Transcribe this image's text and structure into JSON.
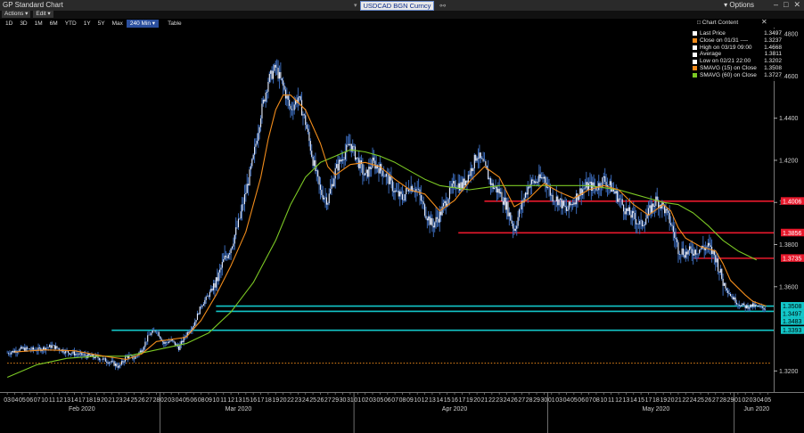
{
  "window": {
    "title": "GP Standard Chart",
    "ticker": "USDCAD BGN Curncy",
    "options_label": "Options"
  },
  "menu": {
    "actions": "Actions",
    "edit": "Edit"
  },
  "toolbar": {
    "ranges": [
      "1D",
      "3D",
      "1M",
      "6M",
      "YTD",
      "1Y",
      "5Y",
      "Max"
    ],
    "interval": "240 Min",
    "table": "Table"
  },
  "chart_content_label": "Chart Content",
  "legend": [
    {
      "label": "Last Price",
      "value": "1.3497",
      "color": "#ffffff"
    },
    {
      "label": "Close on 01/31 ----",
      "value": "1.3237",
      "color": "#f28c1b"
    },
    {
      "label": "High on 03/19 09:00",
      "value": "1.4668",
      "color": "#ffffff"
    },
    {
      "label": "Average",
      "value": "1.3811",
      "color": "#ffffff"
    },
    {
      "label": "Low on 02/21 22:00",
      "value": "1.3202",
      "color": "#ffffff"
    },
    {
      "label": "SMAVG (15)  on Close",
      "value": "1.3508",
      "color": "#f28c1b"
    },
    {
      "label": "SMAVG (60)  on Close",
      "value": "1.3727",
      "color": "#7cc924"
    }
  ],
  "chart_data": {
    "type": "line",
    "ylim": [
      1.31,
      1.483
    ],
    "yticks": [
      "1.4800",
      "1.4600",
      "1.4400",
      "1.4200",
      "1.4000",
      "1.3800",
      "1.3600",
      "1.3200"
    ],
    "ytick_values": [
      1.48,
      1.46,
      1.44,
      1.42,
      1.4,
      1.38,
      1.36,
      1.32
    ],
    "price_tags": [
      {
        "text": "1.4006",
        "value": 1.4006,
        "color": "#e8192c",
        "fg": "#ffffff"
      },
      {
        "text": "1.3856",
        "value": 1.3856,
        "color": "#e8192c",
        "fg": "#ffffff"
      },
      {
        "text": "1.3735",
        "value": 1.3735,
        "color": "#e8192c",
        "fg": "#ffffff"
      },
      {
        "text": "1.3508",
        "value": 1.3508,
        "color": "#13c7c9",
        "fg": "#000000"
      },
      {
        "text": "1.3497",
        "value": 1.3497,
        "color": "#13c7c9",
        "fg": "#000000"
      },
      {
        "text": "1.3483",
        "value": 1.3483,
        "color": "#13c7c9",
        "fg": "#000000"
      },
      {
        "text": "1.3393",
        "value": 1.3393,
        "color": "#13c7c9",
        "fg": "#000000"
      }
    ],
    "days": [
      {
        "label": "03",
        "t": 0
      },
      {
        "label": "04",
        "t": 1
      },
      {
        "label": "05",
        "t": 2
      },
      {
        "label": "06",
        "t": 3
      },
      {
        "label": "07",
        "t": 4
      },
      {
        "label": "10",
        "t": 5
      },
      {
        "label": "11",
        "t": 6
      },
      {
        "label": "12",
        "t": 7
      },
      {
        "label": "13",
        "t": 8
      },
      {
        "label": "14",
        "t": 9
      },
      {
        "label": "17",
        "t": 10
      },
      {
        "label": "18",
        "t": 11
      },
      {
        "label": "19",
        "t": 12
      },
      {
        "label": "20",
        "t": 13
      },
      {
        "label": "21",
        "t": 14
      },
      {
        "label": "23",
        "t": 15
      },
      {
        "label": "24",
        "t": 16
      },
      {
        "label": "25",
        "t": 17
      },
      {
        "label": "26",
        "t": 18
      },
      {
        "label": "27",
        "t": 19
      },
      {
        "label": "28",
        "t": 20
      },
      {
        "label": "02",
        "t": 21
      },
      {
        "label": "03",
        "t": 22
      },
      {
        "label": "04",
        "t": 23
      },
      {
        "label": "05",
        "t": 24
      },
      {
        "label": "06",
        "t": 25
      },
      {
        "label": "08",
        "t": 26
      },
      {
        "label": "09",
        "t": 27
      },
      {
        "label": "10",
        "t": 28
      },
      {
        "label": "11",
        "t": 29
      },
      {
        "label": "12",
        "t": 30
      },
      {
        "label": "13",
        "t": 31
      },
      {
        "label": "15",
        "t": 32
      },
      {
        "label": "16",
        "t": 33
      },
      {
        "label": "17",
        "t": 34
      },
      {
        "label": "18",
        "t": 35
      },
      {
        "label": "19",
        "t": 36
      },
      {
        "label": "20",
        "t": 37
      },
      {
        "label": "22",
        "t": 38
      },
      {
        "label": "23",
        "t": 39
      },
      {
        "label": "24",
        "t": 40
      },
      {
        "label": "25",
        "t": 41
      },
      {
        "label": "26",
        "t": 42
      },
      {
        "label": "27",
        "t": 43
      },
      {
        "label": "29",
        "t": 44
      },
      {
        "label": "30",
        "t": 45
      },
      {
        "label": "31",
        "t": 46
      },
      {
        "label": "01",
        "t": 47
      },
      {
        "label": "02",
        "t": 48
      },
      {
        "label": "03",
        "t": 49
      },
      {
        "label": "05",
        "t": 50
      },
      {
        "label": "06",
        "t": 51
      },
      {
        "label": "07",
        "t": 52
      },
      {
        "label": "08",
        "t": 53
      },
      {
        "label": "09",
        "t": 54
      },
      {
        "label": "10",
        "t": 55
      },
      {
        "label": "12",
        "t": 56
      },
      {
        "label": "13",
        "t": 57
      },
      {
        "label": "14",
        "t": 58
      },
      {
        "label": "15",
        "t": 59
      },
      {
        "label": "16",
        "t": 60
      },
      {
        "label": "17",
        "t": 61
      },
      {
        "label": "19",
        "t": 62
      },
      {
        "label": "20",
        "t": 63
      },
      {
        "label": "21",
        "t": 64
      },
      {
        "label": "22",
        "t": 65
      },
      {
        "label": "23",
        "t": 66
      },
      {
        "label": "24",
        "t": 67
      },
      {
        "label": "26",
        "t": 68
      },
      {
        "label": "27",
        "t": 69
      },
      {
        "label": "28",
        "t": 70
      },
      {
        "label": "29",
        "t": 71
      },
      {
        "label": "30",
        "t": 72
      },
      {
        "label": "01",
        "t": 73
      },
      {
        "label": "03",
        "t": 74
      },
      {
        "label": "04",
        "t": 75
      },
      {
        "label": "05",
        "t": 76
      },
      {
        "label": "06",
        "t": 77
      },
      {
        "label": "07",
        "t": 78
      },
      {
        "label": "08",
        "t": 79
      },
      {
        "label": "10",
        "t": 80
      },
      {
        "label": "11",
        "t": 81
      },
      {
        "label": "12",
        "t": 82
      },
      {
        "label": "13",
        "t": 83
      },
      {
        "label": "14",
        "t": 84
      },
      {
        "label": "15",
        "t": 85
      },
      {
        "label": "17",
        "t": 86
      },
      {
        "label": "18",
        "t": 87
      },
      {
        "label": "19",
        "t": 88
      },
      {
        "label": "20",
        "t": 89
      },
      {
        "label": "21",
        "t": 90
      },
      {
        "label": "22",
        "t": 91
      },
      {
        "label": "24",
        "t": 92
      },
      {
        "label": "25",
        "t": 93
      },
      {
        "label": "26",
        "t": 94
      },
      {
        "label": "27",
        "t": 95
      },
      {
        "label": "28",
        "t": 96
      },
      {
        "label": "29",
        "t": 97
      },
      {
        "label": "01",
        "t": 98
      },
      {
        "label": "02",
        "t": 99
      },
      {
        "label": "03",
        "t": 100
      },
      {
        "label": "04",
        "t": 101
      },
      {
        "label": "05",
        "t": 102
      }
    ],
    "months": [
      {
        "label": "Feb 2020",
        "t": 10
      },
      {
        "label": "Mar 2020",
        "t": 31
      },
      {
        "label": "Apr 2020",
        "t": 60
      },
      {
        "label": "May 2020",
        "t": 87
      },
      {
        "label": "Jun 2020",
        "t": 100.5
      }
    ],
    "month_separators": [
      20.5,
      46.5,
      72.5,
      97.5
    ],
    "close_path": [
      [
        0,
        1.3285
      ],
      [
        2,
        1.3305
      ],
      [
        4,
        1.33
      ],
      [
        6,
        1.3318
      ],
      [
        8,
        1.329
      ],
      [
        10,
        1.3275
      ],
      [
        12,
        1.3265
      ],
      [
        14,
        1.324
      ],
      [
        15,
        1.322
      ],
      [
        16,
        1.327
      ],
      [
        17,
        1.326
      ],
      [
        18,
        1.33
      ],
      [
        19,
        1.337
      ],
      [
        20,
        1.3395
      ],
      [
        21,
        1.333
      ],
      [
        22,
        1.3345
      ],
      [
        23,
        1.331
      ],
      [
        24,
        1.3375
      ],
      [
        25,
        1.342
      ],
      [
        26,
        1.351
      ],
      [
        27,
        1.356
      ],
      [
        28,
        1.362
      ],
      [
        29,
        1.372
      ],
      [
        30,
        1.379
      ],
      [
        31,
        1.39
      ],
      [
        32,
        1.405
      ],
      [
        33,
        1.421
      ],
      [
        34,
        1.442
      ],
      [
        35,
        1.458
      ],
      [
        36,
        1.464
      ],
      [
        37,
        1.455
      ],
      [
        38,
        1.444
      ],
      [
        39,
        1.45
      ],
      [
        40,
        1.438
      ],
      [
        41,
        1.42
      ],
      [
        42,
        1.405
      ],
      [
        43,
        1.401
      ],
      [
        44,
        1.415
      ],
      [
        45,
        1.422
      ],
      [
        46,
        1.428
      ],
      [
        47,
        1.42
      ],
      [
        48,
        1.412
      ],
      [
        49,
        1.419
      ],
      [
        50,
        1.416
      ],
      [
        51,
        1.412
      ],
      [
        52,
        1.405
      ],
      [
        53,
        1.402
      ],
      [
        54,
        1.408
      ],
      [
        55,
        1.406
      ],
      [
        56,
        1.396
      ],
      [
        57,
        1.389
      ],
      [
        58,
        1.394
      ],
      [
        59,
        1.402
      ],
      [
        60,
        1.409
      ],
      [
        61,
        1.408
      ],
      [
        62,
        1.414
      ],
      [
        63,
        1.423
      ],
      [
        64,
        1.417
      ],
      [
        65,
        1.408
      ],
      [
        66,
        1.405
      ],
      [
        67,
        1.398
      ],
      [
        68,
        1.387
      ],
      [
        69,
        1.399
      ],
      [
        70,
        1.409
      ],
      [
        71,
        1.41
      ],
      [
        72,
        1.412
      ],
      [
        73,
        1.403
      ],
      [
        74,
        1.401
      ],
      [
        75,
        1.396
      ],
      [
        76,
        1.401
      ],
      [
        77,
        1.406
      ],
      [
        78,
        1.408
      ],
      [
        79,
        1.407
      ],
      [
        80,
        1.411
      ],
      [
        81,
        1.407
      ],
      [
        82,
        1.402
      ],
      [
        83,
        1.396
      ],
      [
        84,
        1.393
      ],
      [
        85,
        1.389
      ],
      [
        86,
        1.395
      ],
      [
        87,
        1.401
      ],
      [
        88,
        1.398
      ],
      [
        89,
        1.39
      ],
      [
        90,
        1.378
      ],
      [
        91,
        1.376
      ],
      [
        92,
        1.377
      ],
      [
        93,
        1.378
      ],
      [
        94,
        1.379
      ],
      [
        95,
        1.374
      ],
      [
        96,
        1.362
      ],
      [
        97,
        1.356
      ],
      [
        98,
        1.352
      ],
      [
        99,
        1.3505
      ],
      [
        100,
        1.351
      ],
      [
        101,
        1.35
      ],
      [
        101.8,
        1.3497
      ]
    ],
    "sma15": [
      [
        1,
        1.329
      ],
      [
        5,
        1.33
      ],
      [
        9,
        1.3296
      ],
      [
        13,
        1.327
      ],
      [
        16,
        1.3255
      ],
      [
        18,
        1.328
      ],
      [
        20,
        1.334
      ],
      [
        22,
        1.335
      ],
      [
        24,
        1.336
      ],
      [
        26,
        1.344
      ],
      [
        28,
        1.356
      ],
      [
        30,
        1.37
      ],
      [
        32,
        1.386
      ],
      [
        34,
        1.412
      ],
      [
        35,
        1.43
      ],
      [
        36,
        1.444
      ],
      [
        37,
        1.451
      ],
      [
        38,
        1.451
      ],
      [
        40,
        1.444
      ],
      [
        42,
        1.428
      ],
      [
        43,
        1.417
      ],
      [
        44,
        1.413
      ],
      [
        46,
        1.418
      ],
      [
        48,
        1.419
      ],
      [
        50,
        1.417
      ],
      [
        52,
        1.411
      ],
      [
        54,
        1.406
      ],
      [
        56,
        1.404
      ],
      [
        58,
        1.396
      ],
      [
        60,
        1.401
      ],
      [
        62,
        1.41
      ],
      [
        64,
        1.417
      ],
      [
        66,
        1.412
      ],
      [
        68,
        1.398
      ],
      [
        70,
        1.402
      ],
      [
        72,
        1.409
      ],
      [
        74,
        1.405
      ],
      [
        76,
        1.402
      ],
      [
        78,
        1.406
      ],
      [
        80,
        1.408
      ],
      [
        82,
        1.406
      ],
      [
        84,
        1.399
      ],
      [
        86,
        1.394
      ],
      [
        88,
        1.399
      ],
      [
        89,
        1.396
      ],
      [
        90,
        1.388
      ],
      [
        91,
        1.383
      ],
      [
        93,
        1.379
      ],
      [
        95,
        1.377
      ],
      [
        96,
        1.371
      ],
      [
        97,
        1.363
      ],
      [
        99,
        1.356
      ],
      [
        100,
        1.353
      ],
      [
        101.8,
        1.3508
      ]
    ],
    "sma60": [
      [
        0,
        1.317
      ],
      [
        4,
        1.323
      ],
      [
        8,
        1.326
      ],
      [
        12,
        1.327
      ],
      [
        16,
        1.327
      ],
      [
        20,
        1.33
      ],
      [
        24,
        1.333
      ],
      [
        27,
        1.338
      ],
      [
        30,
        1.348
      ],
      [
        33,
        1.362
      ],
      [
        36,
        1.382
      ],
      [
        38,
        1.399
      ],
      [
        40,
        1.412
      ],
      [
        42,
        1.419
      ],
      [
        44,
        1.422
      ],
      [
        46,
        1.425
      ],
      [
        48,
        1.424
      ],
      [
        50,
        1.422
      ],
      [
        52,
        1.419
      ],
      [
        54,
        1.415
      ],
      [
        56,
        1.411
      ],
      [
        58,
        1.408
      ],
      [
        60,
        1.407
      ],
      [
        62,
        1.406
      ],
      [
        64,
        1.407
      ],
      [
        66,
        1.408
      ],
      [
        68,
        1.408
      ],
      [
        70,
        1.408
      ],
      [
        72,
        1.408
      ],
      [
        74,
        1.408
      ],
      [
        76,
        1.408
      ],
      [
        78,
        1.408
      ],
      [
        80,
        1.407
      ],
      [
        82,
        1.406
      ],
      [
        84,
        1.404
      ],
      [
        86,
        1.402
      ],
      [
        88,
        1.4
      ],
      [
        90,
        1.399
      ],
      [
        92,
        1.395
      ],
      [
        94,
        1.389
      ],
      [
        96,
        1.382
      ],
      [
        98,
        1.377
      ],
      [
        100.5,
        1.3727
      ]
    ],
    "reference_lines": [
      {
        "name": "close-0131-dotted",
        "value": 1.3237,
        "t_start": 0,
        "t_end": 102.5,
        "color": "#f28c1b",
        "style": "dotted"
      },
      {
        "name": "resistance-1.4006",
        "value": 1.4006,
        "t_start": 64,
        "t_end": 102.8,
        "color": "#e8192c",
        "style": "solid"
      },
      {
        "name": "resistance-1.3856",
        "value": 1.3856,
        "t_start": 60.5,
        "t_end": 102.8,
        "color": "#e8192c",
        "style": "solid"
      },
      {
        "name": "resistance-1.3735",
        "value": 1.3735,
        "t_start": 92,
        "t_end": 102.8,
        "color": "#e8192c",
        "style": "solid"
      },
      {
        "name": "support-1.3508",
        "value": 1.3508,
        "t_start": 28,
        "t_end": 102.8,
        "color": "#13c7c9",
        "style": "solid"
      },
      {
        "name": "support-1.3483",
        "value": 1.3483,
        "t_start": 28,
        "t_end": 102.8,
        "color": "#13c7c9",
        "style": "solid"
      },
      {
        "name": "support-1.3393",
        "value": 1.3393,
        "t_start": 14,
        "t_end": 102.8,
        "color": "#13c7c9",
        "style": "solid"
      }
    ]
  }
}
